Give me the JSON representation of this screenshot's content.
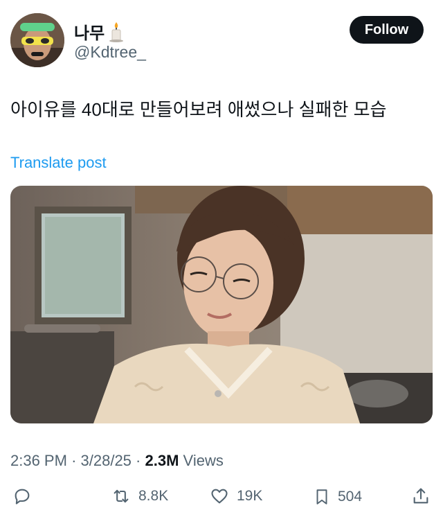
{
  "user": {
    "name": "나무",
    "handle": "@Kdtree_",
    "follow_label": "Follow"
  },
  "tweet": {
    "text": "아이유를 40대로 만들어보려 애썼으나 실패한 모습",
    "translate_label": "Translate post"
  },
  "meta": {
    "time": "2:36 PM",
    "date": "3/28/25",
    "views_count": "2.3M",
    "views_label": "Views"
  },
  "actions": {
    "retweets": "8.8K",
    "likes": "19K",
    "bookmarks": "504"
  },
  "colors": {
    "link": "#1d9bf0",
    "muted": "#536471",
    "text": "#0f1419"
  }
}
